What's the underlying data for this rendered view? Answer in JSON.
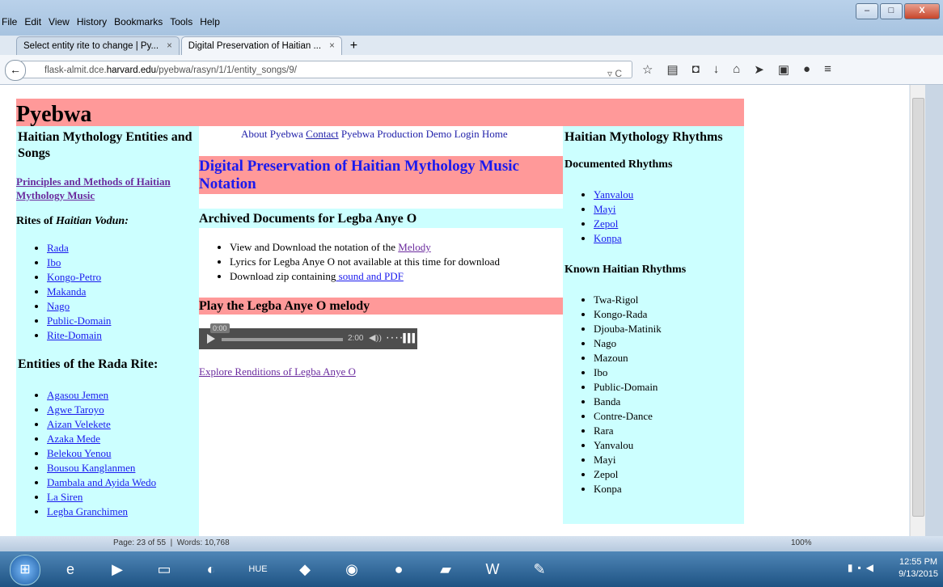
{
  "browser": {
    "menu": [
      "File",
      "Edit",
      "View",
      "History",
      "Bookmarks",
      "Tools",
      "Help"
    ],
    "tabs": [
      {
        "label": "Select entity rite to change | Py..."
      },
      {
        "label": "Digital Preservation of Haitian ..."
      }
    ],
    "url_prefix": "flask-almit.dce.",
    "url_domain": "harvard.edu",
    "url_path": "/pyebwa/rasyn/1/1/entity_songs/9/"
  },
  "page": {
    "site_title": "Pyebwa",
    "nav": [
      "About Pyebwa",
      "Contact",
      "Pyebwa Production",
      "Demo",
      "Login",
      "Home"
    ],
    "left": {
      "heading": "Haitian Mythology Entities and Songs",
      "principles_link": "Principles and Methods of Haitian Mythology Music",
      "rites_label": "Rites of ",
      "rites_label_italic": "Haitian Vodun:",
      "rites": [
        "Rada",
        "Ibo",
        "Kongo-Petro",
        "Makanda",
        "Nago",
        "Public-Domain",
        "Rite-Domain"
      ],
      "entities_heading": "Entities of the Rada Rite:",
      "entities": [
        "Agasou Jemen",
        "Agwe Taroyo",
        "Aizan Velekete",
        "Azaka Mede",
        "Belekou Yenou",
        "Bousou Kanglanmen",
        "Dambala and Ayida Wedo",
        "La Siren",
        "Legba Granchimen"
      ]
    },
    "main": {
      "title": "Digital Preservation of Haitian Mythology Music Notation",
      "archived_heading": "Archived Documents for Legba Anye O",
      "doc1_text": "View and Download the notation of the ",
      "doc1_link": "Melody",
      "doc2_text": "Lyrics for Legba Anye O not available at this time for download",
      "doc3_text": "Download zip containing",
      "doc3_link": " sound and PDF",
      "play_heading": "Play the Legba Anye O melody",
      "player_current": "0:00",
      "player_duration": "2:00",
      "explore_link": "Explore Renditions of Legba Anye O"
    },
    "right": {
      "heading": "Haitian Mythology Rhythms",
      "documented_heading": "Documented Rhythms",
      "documented": [
        "Yanvalou",
        "Mayi",
        "Zepol",
        "Konpa"
      ],
      "known_heading": "Known Haitian Rhythms",
      "known": [
        "Twa-Rigol",
        "Kongo-Rada",
        "Djouba-Matinik",
        "Nago",
        "Mazoun",
        "Ibo",
        "Public-Domain",
        "Banda",
        "Contre-Dance",
        "Rara",
        "Yanvalou",
        "Mayi",
        "Zepol",
        "Konpa"
      ]
    }
  },
  "word_status": {
    "page": "Page: 23 of 55",
    "words": "Words: 10,768",
    "zoom": "100%"
  },
  "taskbar": {
    "time": "12:55 PM",
    "date": "9/13/2015"
  },
  "colors": {
    "header_pink": "#ff9999",
    "column_cyan": "#ccffff",
    "link_blue": "#1a1aee",
    "visited_purple": "#6b2b9e"
  }
}
